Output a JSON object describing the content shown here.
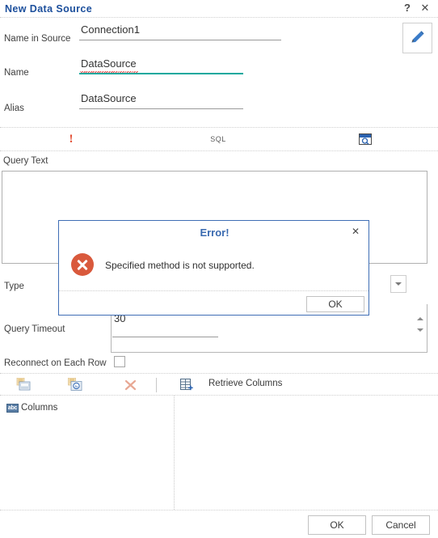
{
  "window": {
    "title": "New Data Source",
    "help_icon": "?",
    "close_icon": "✕"
  },
  "form": {
    "name_in_source": {
      "label": "Name in Source",
      "value": "Connection1",
      "placeholder": ""
    },
    "name": {
      "label": "Name",
      "value": "DataSource",
      "placeholder": "",
      "focus_underline_color": "#13a89e",
      "spellcheck_underline_color": "#e03a3a"
    },
    "alias": {
      "label": "Alias",
      "value": "DataSource",
      "placeholder": ""
    },
    "edit_button_icon": "pencil-icon"
  },
  "sql_toolbar": {
    "execute_label": "!",
    "sql_label": "SQL",
    "preview_icon": "query-preview-icon"
  },
  "query": {
    "label": "Query Text",
    "value": "",
    "placeholder": ""
  },
  "type_row": {
    "label": "Type",
    "value": "",
    "dropdown_icon": "chevron-down-icon"
  },
  "timeout_row": {
    "label": "Query Timeout",
    "value": "30",
    "spinner_up_icon": "spinner-up-icon",
    "spinner_down_icon": "spinner-down-icon"
  },
  "reconnect_row": {
    "label": "Reconnect on Each Row",
    "checked": false
  },
  "bottom_toolbar": {
    "items": [
      {
        "name": "add-column-icon",
        "label": ""
      },
      {
        "name": "add-calculated-column-icon",
        "label": ""
      },
      {
        "name": "delete-column-icon",
        "label": ""
      },
      {
        "name": "retrieve-columns-icon",
        "label": ""
      }
    ],
    "retrieve_columns_label": "Retrieve Columns"
  },
  "tree": {
    "items": [
      {
        "badge": "abc",
        "label": "Columns"
      }
    ]
  },
  "footer": {
    "ok_label": "OK",
    "cancel_label": "Cancel"
  },
  "error_dialog": {
    "title": "Error!",
    "close_icon": "✕",
    "message": "Specified method is not supported.",
    "ok_label": "OK",
    "icon": "error-circle-x-icon",
    "icon_color": "#d9593c",
    "title_color": "#3a6ab0",
    "border_color": "#3f6eb5"
  }
}
